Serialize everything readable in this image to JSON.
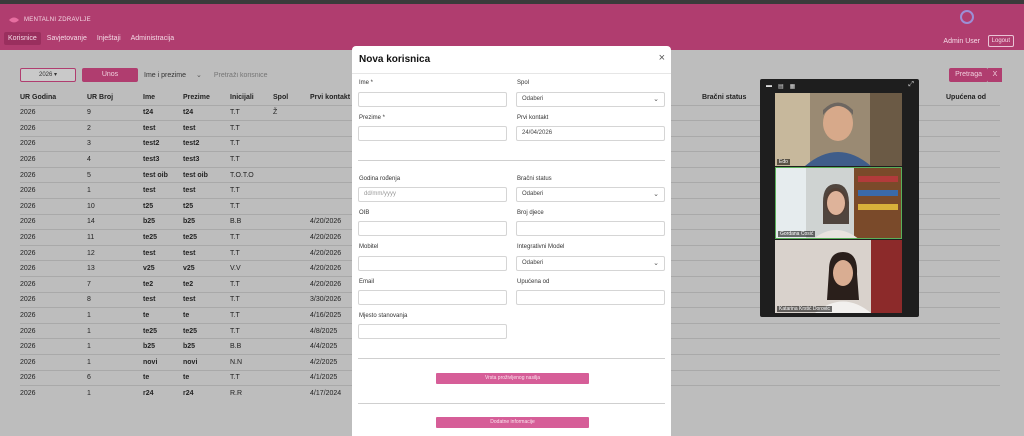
{
  "navbar": {
    "logo_text": "MENTALNI ZDRAVLJE",
    "brand_text": "",
    "tabs": [
      "Korisnice",
      "Savjetovanje",
      "Inještaji",
      "Administracija"
    ],
    "active_tab": "Korisnice",
    "admin_user": "Admin User",
    "logout": "Logout"
  },
  "filters": {
    "year": "2026 ▾",
    "unos": "Unos",
    "search_by": "Ime i prezime",
    "search_placeholder": "Pretraži korisnice",
    "pretraga": "Pretraga",
    "clear": "X"
  },
  "table": {
    "columns": [
      "UR Godina",
      "UR Broj",
      "Ime",
      "Prezime",
      "Inicijali",
      "Spol",
      "Prvi kontakt"
    ],
    "extra_headers": [
      "Bračni status",
      "Upućena od"
    ],
    "rows": [
      [
        "2026",
        "9",
        "t24",
        "t24",
        "T.T",
        "Ž",
        ""
      ],
      [
        "2026",
        "2",
        "test",
        "test",
        "T.T",
        "",
        ""
      ],
      [
        "2026",
        "3",
        "test2",
        "test2",
        "T.T",
        "",
        ""
      ],
      [
        "2026",
        "4",
        "test3",
        "test3",
        "T.T",
        "",
        ""
      ],
      [
        "2026",
        "5",
        "test oib",
        "test oib",
        "T.O.T.O",
        "",
        ""
      ],
      [
        "2026",
        "1",
        "test",
        "test",
        "T.T",
        "",
        ""
      ],
      [
        "2026",
        "10",
        "t25",
        "t25",
        "T.T",
        "",
        ""
      ],
      [
        "2026",
        "14",
        "b25",
        "b25",
        "B.B",
        "",
        "4/20/2026"
      ],
      [
        "2026",
        "11",
        "te25",
        "te25",
        "T.T",
        "",
        "4/20/2026"
      ],
      [
        "2026",
        "12",
        "test",
        "test",
        "T.T",
        "",
        "4/20/2026"
      ],
      [
        "2026",
        "13",
        "v25",
        "v25",
        "V.V",
        "",
        "4/20/2026"
      ],
      [
        "2026",
        "7",
        "te2",
        "te2",
        "T.T",
        "",
        "4/20/2026"
      ],
      [
        "2026",
        "8",
        "test",
        "test",
        "T.T",
        "",
        "3/30/2026"
      ],
      [
        "2026",
        "1",
        "te",
        "te",
        "T.T",
        "",
        "4/16/2025"
      ],
      [
        "2026",
        "1",
        "te25",
        "te25",
        "T.T",
        "",
        "4/8/2025"
      ],
      [
        "2026",
        "1",
        "b25",
        "b25",
        "B.B",
        "",
        "4/4/2025"
      ],
      [
        "2026",
        "1",
        "novi",
        "novi",
        "N.N",
        "",
        "4/2/2025"
      ],
      [
        "2026",
        "6",
        "te",
        "te",
        "T.T",
        "",
        "4/1/2025"
      ],
      [
        "2026",
        "1",
        "r24",
        "r24",
        "R.R",
        "",
        "4/17/2024"
      ]
    ]
  },
  "modal": {
    "title": "Nova korisnica",
    "close": "×",
    "ime_label": "Ime *",
    "ime_value": "",
    "spol_label": "Spol",
    "spol_value": "Odaberi",
    "prezime_label": "Prezime *",
    "prezime_value": "",
    "prvi_kontakt_label": "Prvi kontakt",
    "prvi_kontakt_value": "24/04/2026",
    "godina_label": "Godina rođenja",
    "godina_placeholder": "dd/mm/yyyy",
    "bracni_label": "Bračni status",
    "bracni_value": "Odaberi",
    "oib_label": "OIB",
    "oib_value": "",
    "broj_djece_label": "Broj djece",
    "broj_djece_value": "",
    "mobitel_label": "Mobitel",
    "mobitel_value": "",
    "integrativni_label": "Integrativni Model",
    "integrativni_value": "Odaberi",
    "email_label": "Email",
    "email_value": "",
    "upucena_label": "Upućena od",
    "upucena_value": "",
    "mjesto_label": "Mjesto stanovanja",
    "mjesto_value": "",
    "btn_nasilje": "Vrsta proživljenog nasilja",
    "btn_dodatne": "Dodatne informacije"
  },
  "video": {
    "participants": [
      "Edo",
      "Gordana Ćosić",
      "Katarina Krstić Dorovic"
    ]
  },
  "colors": {
    "brand": "#b03d6f",
    "button_pink": "#d65e98"
  }
}
